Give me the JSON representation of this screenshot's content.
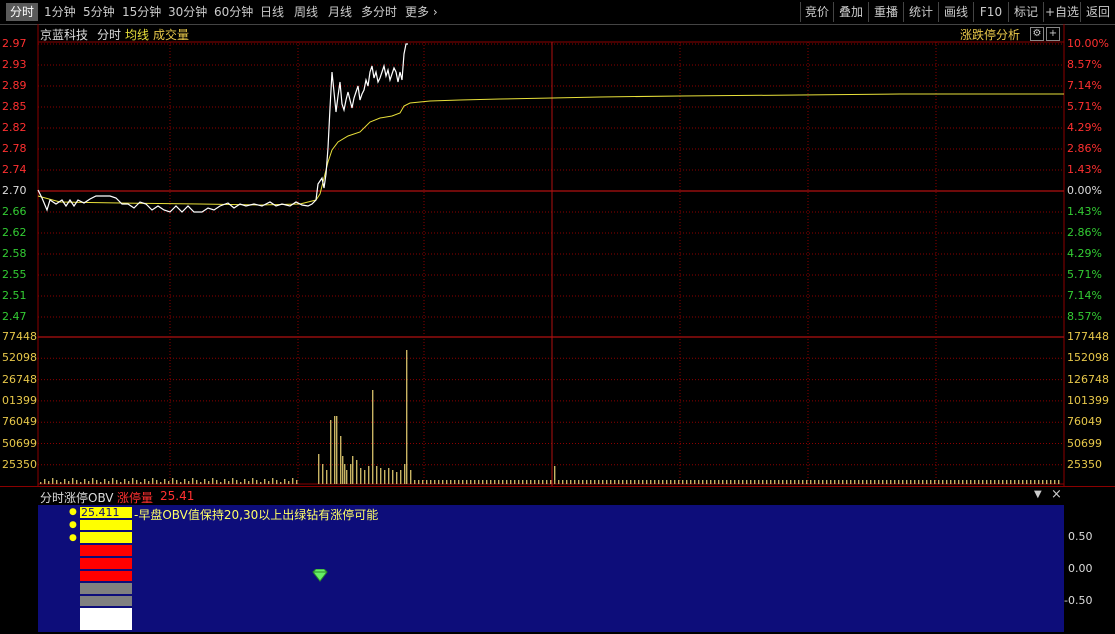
{
  "toolbar": {
    "periods": [
      "分时",
      "1分钟",
      "5分钟",
      "15分钟",
      "30分钟",
      "60分钟",
      "日线",
      "周线",
      "月线",
      "多分时",
      "更多"
    ],
    "active_period": "分时",
    "right_buttons": [
      "竞价",
      "叠加",
      "重播",
      "统计",
      "画线",
      "F10",
      "标记",
      "+自选",
      "返回"
    ],
    "more_chevron": "›"
  },
  "main_chart": {
    "stock_name": "京蓝科技",
    "mode_label": "分时",
    "avg_label": "均线",
    "volume_label": "成交量",
    "analysis_button": "涨跌停分析",
    "price_labels": [
      "2.97",
      "2.93",
      "2.89",
      "2.85",
      "2.82",
      "2.78",
      "2.74",
      "2.70",
      "2.66",
      "2.62",
      "2.58",
      "2.55",
      "2.51",
      "2.47"
    ],
    "pct_labels": [
      "10.00%",
      "8.57%",
      "7.14%",
      "5.71%",
      "4.29%",
      "2.86%",
      "1.43%",
      "0.00%",
      "1.43%",
      "2.86%",
      "4.29%",
      "5.71%",
      "7.14%",
      "8.57%"
    ]
  },
  "volume_chart": {
    "left_labels": [
      "77448",
      "52098",
      "26748",
      "01399",
      "76049",
      "50699",
      "25350"
    ],
    "right_labels": [
      "177448",
      "152098",
      "126748",
      "101399",
      "76049",
      "50699",
      "25350"
    ]
  },
  "indicator": {
    "name": "分时涨停OBV",
    "sub_label": "涨停量",
    "sub_value": "25.41",
    "box_value": "25.411",
    "note": "早盘OBV值保持20,30以上出绿钻有涨停可能",
    "y_labels": [
      "0.50",
      "0.00",
      "-0.50"
    ],
    "dropdown_icon": "▼",
    "close_icon": "×"
  },
  "colors": {
    "price_line": "#ffffff",
    "avg_line": "#e8e03a",
    "grid": "#8b0000",
    "volume": "#c8b464",
    "indicator_bg": "#0d0d7a",
    "yellow_bar": "#ffff00",
    "red_bar": "#ff0000",
    "gray_bar": "#808080",
    "white_bar": "#ffffff",
    "diamond": "#66ee66"
  }
}
